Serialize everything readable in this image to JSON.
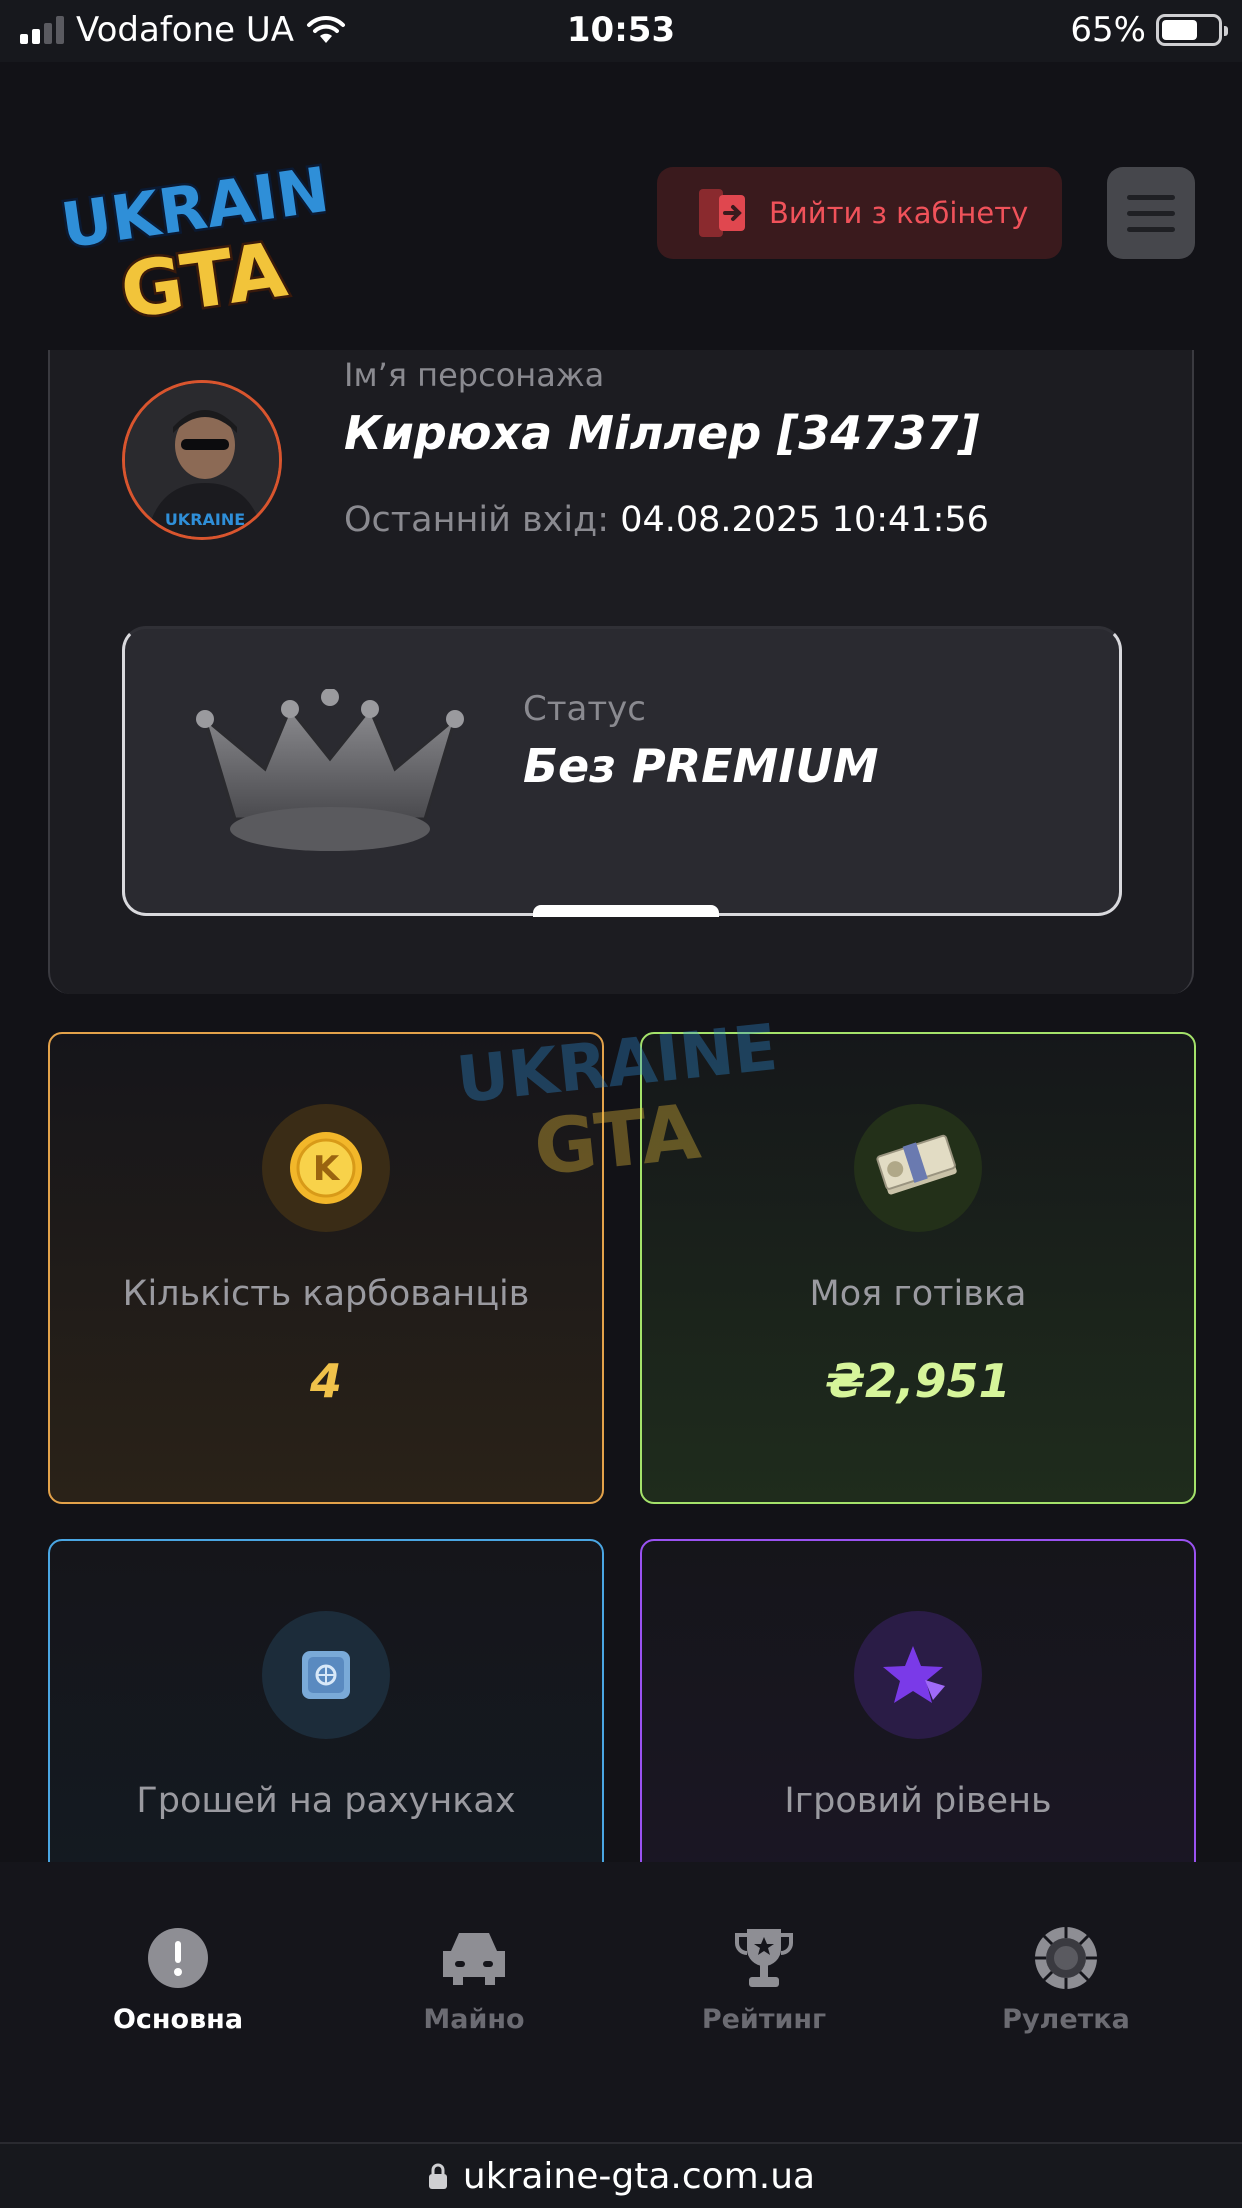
{
  "status_bar": {
    "carrier": "Vodafone UA",
    "time": "10:53",
    "battery": "65%",
    "battery_level": 0.65
  },
  "header": {
    "logout_label": "Вийти з кабінету"
  },
  "profile": {
    "name_label": "Ім’я персонажа",
    "name": "Кирюха Міллер [34737]",
    "last_login_label": "Останній вхід:",
    "last_login_value": "04.08.2025 10:41:56",
    "status_label": "Статус",
    "status_value": "Без PREMIUM"
  },
  "stats": {
    "coins": {
      "label": "Кількість карбованців",
      "value": "4",
      "color": "#f0c24a"
    },
    "cash": {
      "label": "Моя готівка",
      "value": "₴2,951",
      "color": "#d6f59a"
    },
    "bank": {
      "label": "Грошей на рахунках"
    },
    "level": {
      "label": "Ігровий рівень"
    }
  },
  "nav": {
    "items": [
      {
        "label": "Основна",
        "icon": "info-icon"
      },
      {
        "label": "Майно",
        "icon": "car-icon"
      },
      {
        "label": "Рейтинг",
        "icon": "trophy-icon"
      },
      {
        "label": "Рулетка",
        "icon": "roulette-icon"
      }
    ]
  },
  "url_bar": {
    "url": "ukraine-gta.com.ua"
  },
  "colors": {
    "accent_red": "#f0525a",
    "coins_border": "#e3a24a",
    "cash_border": "#a4e26a",
    "bank_border": "#4aa6e3",
    "level_border": "#9a52f2"
  }
}
